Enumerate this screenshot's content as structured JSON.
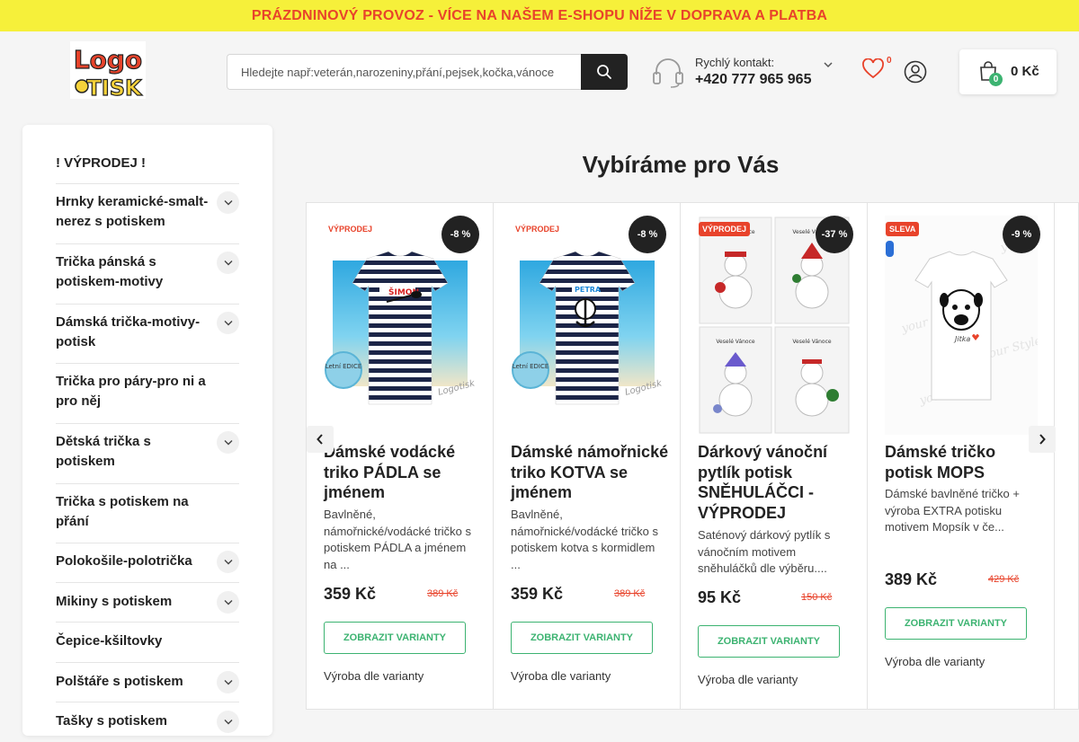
{
  "topbar": {
    "text": "PRÁZDNINOVÝ PROVOZ - VÍCE NA NAŠEM E-SHOPU NÍŽE V DOPRAVA A PLATBA"
  },
  "header": {
    "logo_text_top": "Logo",
    "logo_text_bottom": "TISK",
    "search_placeholder": "Hledejte např:veterán,narozeniny,přání,pejsek,kočka,vánoce",
    "contact_label": "Rychlý kontakt:",
    "contact_phone": "+420 777 965 965",
    "wishlist_count": "0",
    "cart_count": "0",
    "cart_total": "0 Kč"
  },
  "sidebar": {
    "items": [
      {
        "label": "! VÝPRODEJ !",
        "expandable": false
      },
      {
        "label": "Hrnky keramické-smalt-nerez s potiskem",
        "expandable": true
      },
      {
        "label": "Trička pánská s potiskem-motivy",
        "expandable": true
      },
      {
        "label": "Dámská trička-motivy-potisk",
        "expandable": true
      },
      {
        "label": "Trička pro páry-pro ni a pro něj",
        "expandable": false
      },
      {
        "label": "Dětská trička s potiskem",
        "expandable": true
      },
      {
        "label": "Trička s potiskem na přání",
        "expandable": false
      },
      {
        "label": "Polokošile-polotrička",
        "expandable": true
      },
      {
        "label": "Mikiny s potiskem",
        "expandable": true
      },
      {
        "label": "Čepice-kšiltovky",
        "expandable": false
      },
      {
        "label": "Polštáře s potiskem",
        "expandable": true
      },
      {
        "label": "Tašky s potiskem",
        "expandable": true
      }
    ]
  },
  "main": {
    "title": "Vybíráme pro Vás",
    "products": [
      {
        "tag": "VÝPRODEJ",
        "discount": "-8 %",
        "name": "Dámské vodácké triko PÁDLA se jménem",
        "description": "Bavlněné, námořnické/vodácké tričko s potiskem PÁDLA a jménem na ...",
        "price": "359 Kč",
        "old_price": "389 Kč",
        "button": "ZOBRAZIT VARIANTY",
        "availability": "Výroba dle varianty",
        "image_caption": "Letní EDICE",
        "watermark": "Logotisk"
      },
      {
        "tag": "VÝPRODEJ",
        "discount": "-8 %",
        "name": "Dámské námořnické triko KOTVA se jménem",
        "description": "Bavlněné, námořnické/vodácké tričko s potiskem kotva s kormidlem ...",
        "price": "359 Kč",
        "old_price": "389 Kč",
        "button": "ZOBRAZIT VARIANTY",
        "availability": "Výroba dle varianty",
        "image_caption": "Letní EDICE",
        "watermark": "Logotisk"
      },
      {
        "tag": "VÝPRODEJ",
        "discount": "-37 %",
        "name": "Dárkový vánoční pytlík potisk SNĚHULÁČCI - VÝPRODEJ",
        "description": "Saténový dárkový pytlík s vánočním motivem sněhuláčků dle výběru....",
        "price": "95 Kč",
        "old_price": "150 Kč",
        "button": "ZOBRAZIT VARIANTY",
        "availability": "Výroba dle varianty",
        "image_caption": "Veselé Vánoce"
      },
      {
        "tag": "SLEVA",
        "discount": "-9 %",
        "name": "Dámské tričko potisk MOPS",
        "description": "Dámské bavlněné tričko + výroba EXTRA potisku motivem Mopsík v če...",
        "price": "389 Kč",
        "old_price": "429 Kč",
        "button": "ZOBRAZIT VARIANTY",
        "availability": "Výroba dle varianty",
        "image_caption": "your Style"
      }
    ]
  },
  "colors": {
    "accent_red": "#e8432b",
    "accent_green": "#3cb371",
    "topbar_yellow": "#f6f03a"
  },
  "icons": [
    "search-icon",
    "headset-icon",
    "chevron-down-icon",
    "heart-icon",
    "user-icon",
    "bag-icon",
    "chevron-left-icon",
    "chevron-right-icon"
  ]
}
